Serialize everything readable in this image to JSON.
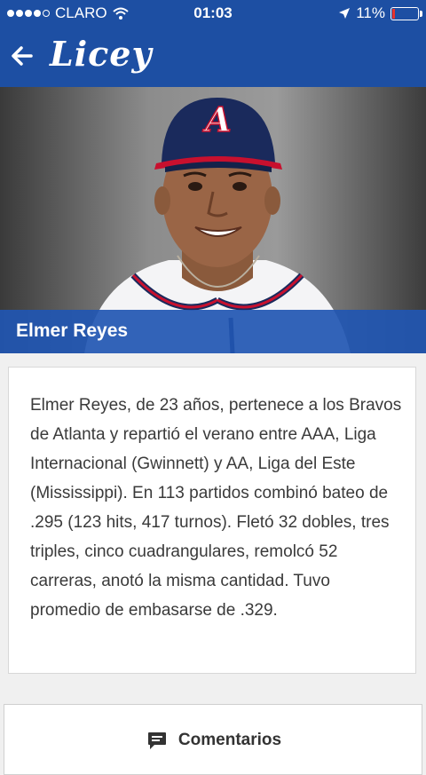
{
  "status_bar": {
    "carrier": "CLARO",
    "time": "01:03",
    "battery": "11%",
    "battery_level": 0.11,
    "signal_bars_filled": 4,
    "signal_bars_total": 5
  },
  "header": {
    "logo_text": "Licey",
    "brand_color": "#1d4fa3"
  },
  "player": {
    "name": "Elmer Reyes",
    "bio": "Elmer Reyes, de 23 años, pertenece a los Bravos de Atlanta y repartió el verano entre AAA, Liga Internacional (Gwinnett) y AA, Liga del Este (Mississippi). En 113 partidos combinó bateo de .295 (123 hits, 417 turnos). Fletó 32 dobles, tres triples, cinco cuadrangulares, remolcó 52 carreras, anotó la misma cantidad. Tuvo promedio de embasarse de .329.",
    "cap_logo": "A"
  },
  "comments": {
    "label": "Comentarios",
    "icon": "comment-icon"
  }
}
